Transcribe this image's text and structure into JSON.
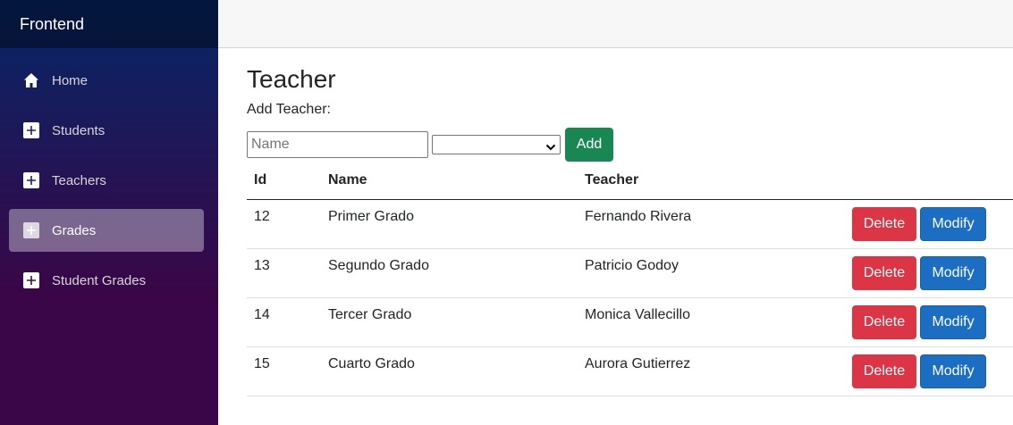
{
  "app": {
    "brand": "Frontend"
  },
  "sidebar": {
    "items": [
      {
        "label": "Home",
        "icon": "home-icon",
        "active": false
      },
      {
        "label": "Students",
        "icon": "plus-icon",
        "active": false
      },
      {
        "label": "Teachers",
        "icon": "plus-icon",
        "active": false
      },
      {
        "label": "Grades",
        "icon": "plus-icon",
        "active": true
      },
      {
        "label": "Student Grades",
        "icon": "plus-icon",
        "active": false
      }
    ]
  },
  "page": {
    "title": "Teacher",
    "add_label": "Add Teacher:",
    "form": {
      "name_placeholder": "Name",
      "name_value": "",
      "teacher_select_value": "",
      "add_button": "Add"
    },
    "table": {
      "headers": [
        "Id",
        "Name",
        "Teacher"
      ],
      "rows": [
        {
          "id": "12",
          "name": "Primer Grado",
          "teacher": "Fernando Rivera"
        },
        {
          "id": "13",
          "name": "Segundo Grado",
          "teacher": "Patricio Godoy"
        },
        {
          "id": "14",
          "name": "Tercer Grado",
          "teacher": "Monica Vallecillo"
        },
        {
          "id": "15",
          "name": "Cuarto Grado",
          "teacher": "Aurora Gutierrez"
        }
      ],
      "delete_label": "Delete",
      "modify_label": "Modify"
    }
  },
  "colors": {
    "add_button": "#198754",
    "delete_button": "#dc3545",
    "modify_button": "#1b6ec2",
    "sidebar_top": "#052767",
    "sidebar_bottom": "#3a0647"
  }
}
